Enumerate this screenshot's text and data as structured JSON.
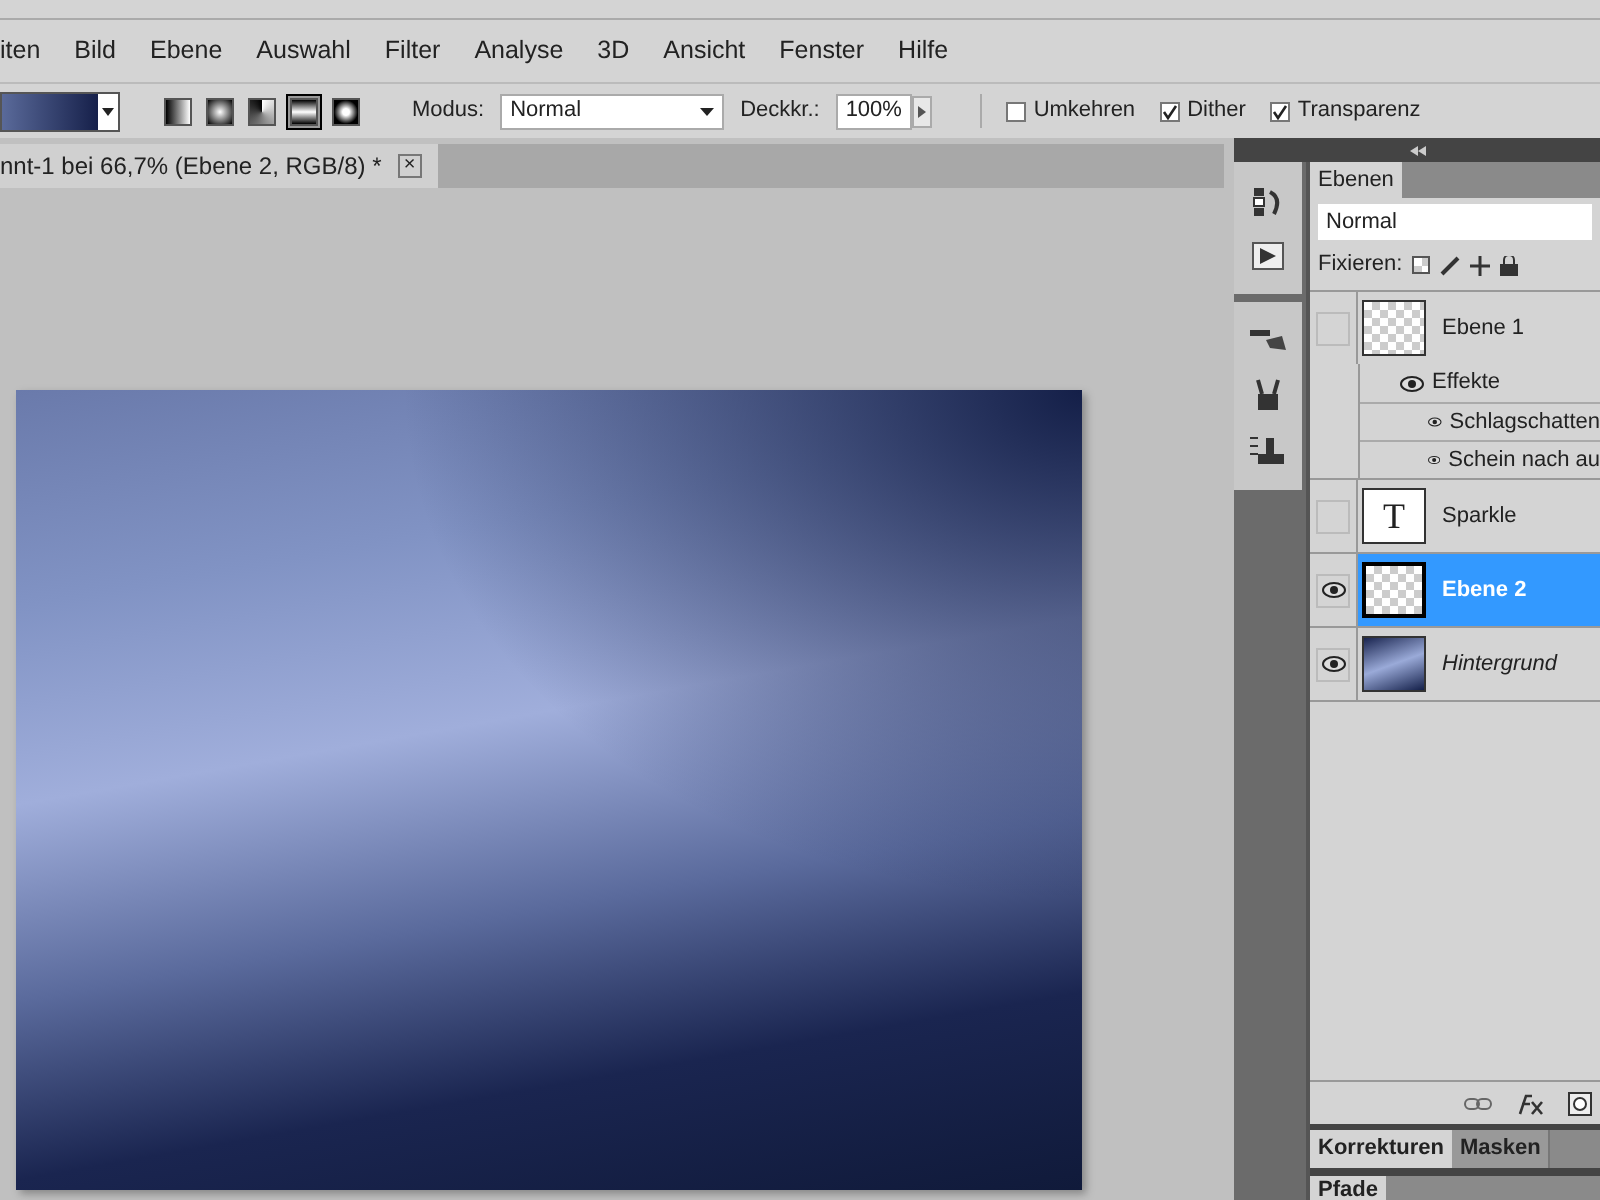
{
  "menu": [
    "iten",
    "Bild",
    "Ebene",
    "Auswahl",
    "Filter",
    "Analyse",
    "3D",
    "Ansicht",
    "Fenster",
    "Hilfe"
  ],
  "options": {
    "shapes": [
      {
        "kind": "linear",
        "selected": false
      },
      {
        "kind": "radial",
        "selected": false
      },
      {
        "kind": "angle",
        "selected": false
      },
      {
        "kind": "reflected",
        "selected": true
      },
      {
        "kind": "diamond",
        "selected": false
      }
    ],
    "mode_label": "Modus:",
    "mode": "Normal",
    "opacity_label": "Deckkr.:",
    "opacity": "100%",
    "checks": [
      {
        "label": "Umkehren",
        "checked": false
      },
      {
        "label": "Dither",
        "checked": true
      },
      {
        "label": "Transparenz",
        "checked": true
      }
    ]
  },
  "document_tab": {
    "title": "nnt-1 bei 66,7% (Ebene 2, RGB/8) *",
    "close": "×"
  },
  "layers_panel": {
    "tab": "Ebenen",
    "blend_mode": "Normal",
    "lock_label": "Fixieren:",
    "layers": [
      {
        "name": "Ebene 1",
        "kind": "transparent",
        "visible": false,
        "selected": false,
        "italic": false,
        "children": [
          {
            "name": "Effekte",
            "children": [
              {
                "name": "Schlagschatten"
              },
              {
                "name": "Schein nach au"
              }
            ]
          }
        ]
      },
      {
        "name": "Sparkle",
        "kind": "text",
        "thumb_text": "T",
        "visible": false,
        "selected": false,
        "italic": false
      },
      {
        "name": "Ebene 2",
        "kind": "transparent",
        "visible": true,
        "selected": true,
        "italic": false
      },
      {
        "name": "Hintergrund",
        "kind": "gradient",
        "visible": true,
        "selected": false,
        "italic": true
      }
    ]
  },
  "bottom_tabs": [
    {
      "label": "Korrekturen",
      "selected": true
    },
    {
      "label": "Masken",
      "selected": false
    }
  ],
  "next_panel_tab": "Pfade"
}
